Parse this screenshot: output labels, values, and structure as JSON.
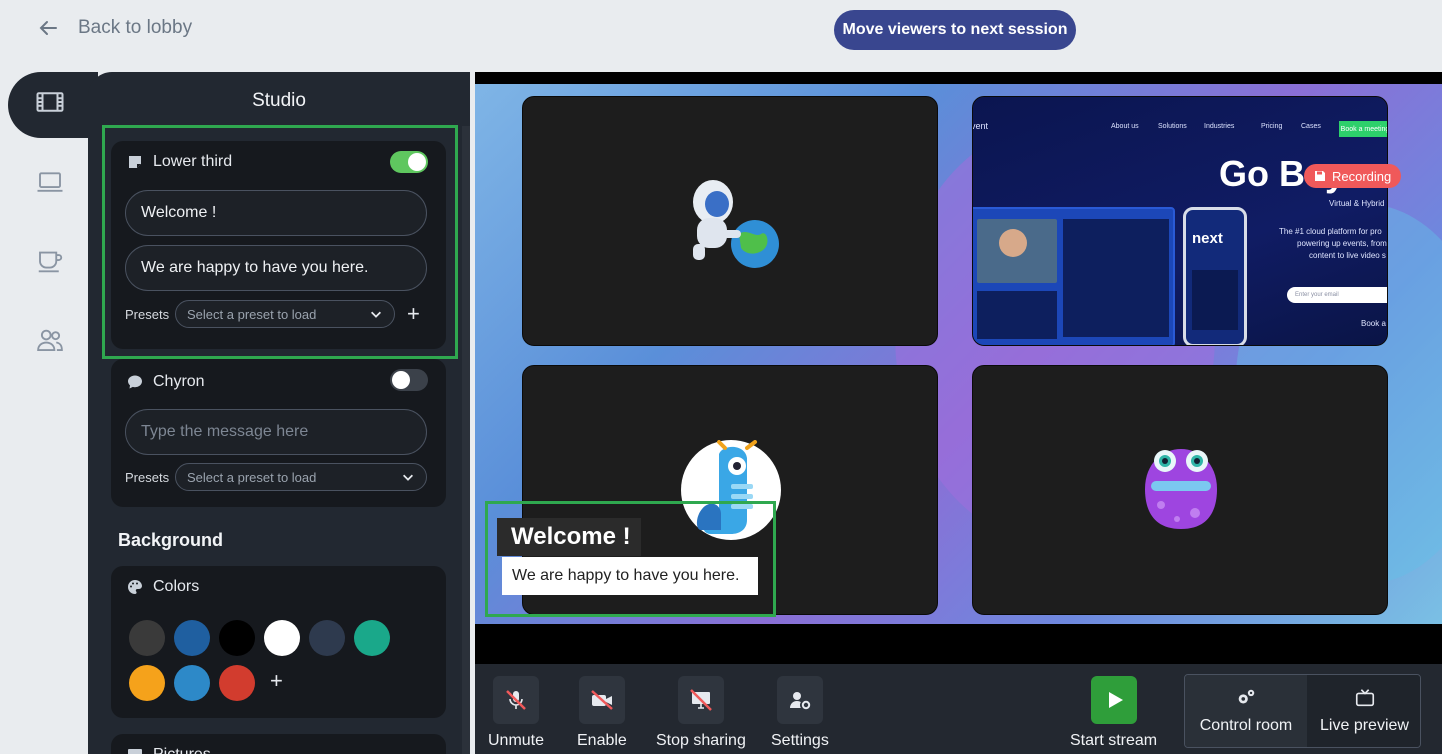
{
  "topbar": {
    "back_label": "Back to lobby",
    "move_viewers_label": "Move viewers to next session"
  },
  "rail": {
    "icons": [
      "film-icon",
      "laptop-icon",
      "coffee-icon",
      "users-icon"
    ],
    "active": "film-icon"
  },
  "panel": {
    "title": "Studio",
    "lower_third": {
      "label": "Lower third",
      "enabled": true,
      "title_value": "Welcome !",
      "subtitle_value": "We are happy to have you here.",
      "presets_label": "Presets",
      "preset_placeholder": "Select a preset to load"
    },
    "chyron": {
      "label": "Chyron",
      "enabled": false,
      "message_placeholder": "Type the message here",
      "presets_label": "Presets",
      "preset_placeholder": "Select a preset to load"
    },
    "background": {
      "title": "Background",
      "colors_label": "Colors",
      "colors": [
        "#3a3a3a",
        "#1f5fa0",
        "#000000",
        "#ffffff",
        "#2e3a4e",
        "#1aa88a",
        "#f5a21b",
        "#2d89c8",
        "#d23c2e"
      ],
      "pictures_label": "Pictures"
    }
  },
  "stage": {
    "recording_label": "Recording",
    "shared_site": {
      "brand": "vent",
      "nav": [
        "About us",
        "Solutions",
        "Industries",
        "Pricing",
        "Cases"
      ],
      "cta": "Book a meeting",
      "hero": "Go Beyon",
      "subhero": "Virtual & Hybrid",
      "body_line1": "The #1 cloud platform for pro",
      "body_line2": "powering up events, from",
      "body_line3": "content to live video s",
      "email_placeholder": "Enter your email",
      "book": "Book a",
      "phone_brand": "next"
    },
    "lower_third": {
      "title": "Welcome !",
      "subtitle": "We are happy to have you here."
    }
  },
  "controls": {
    "unmute": "Unmute",
    "enable": "Enable",
    "stop_sharing": "Stop sharing",
    "settings": "Settings",
    "start_stream": "Start stream",
    "control_room": "Control room",
    "live_preview": "Live preview"
  },
  "colors": {
    "accent": "#39468f",
    "highlight": "#2fa84f",
    "recording": "#f0595a",
    "toggle_on": "#5fc75f",
    "start_stream": "#2f9e3a"
  }
}
